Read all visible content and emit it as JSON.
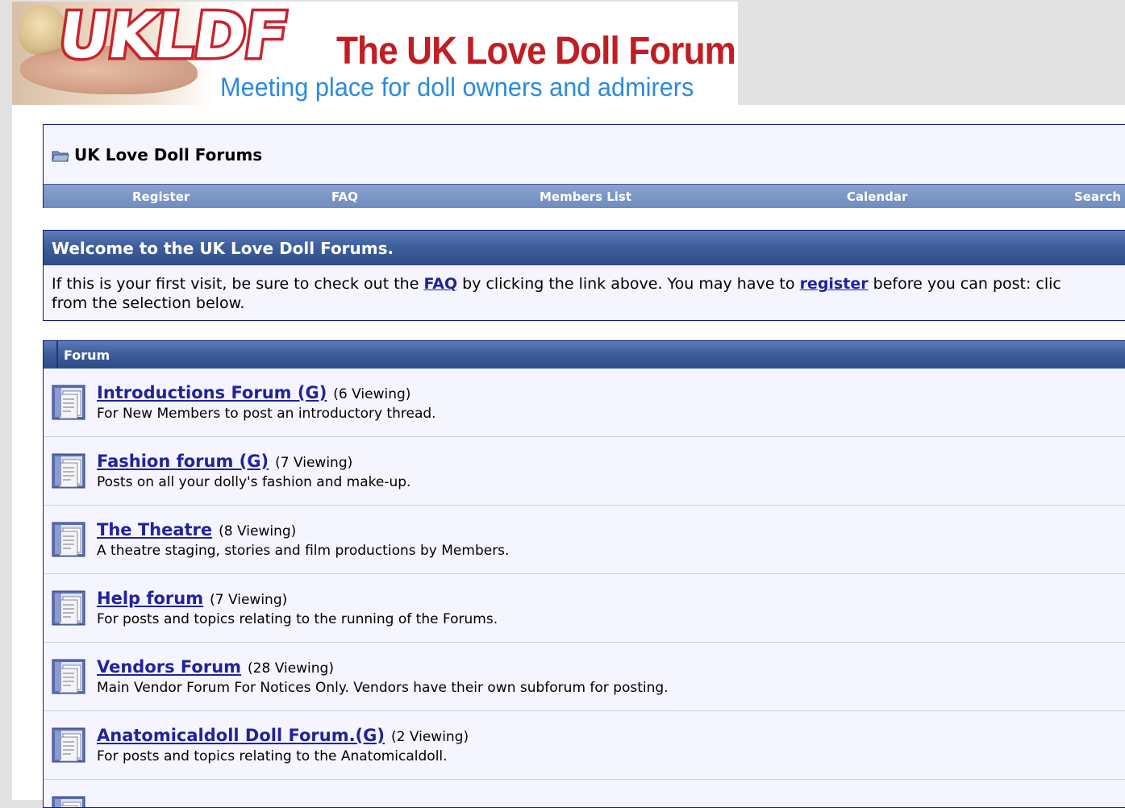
{
  "banner": {
    "logo_text": "UKLDF",
    "title": "The UK Love Doll Forum",
    "tagline": "Meeting place for doll owners and admirers"
  },
  "breadcrumb": {
    "title": "UK Love Doll Forums",
    "icon": "folder-icon"
  },
  "navbar": {
    "items": [
      {
        "label": "Register"
      },
      {
        "label": "FAQ"
      },
      {
        "label": "Members List"
      },
      {
        "label": "Calendar"
      },
      {
        "label": "Search"
      }
    ]
  },
  "welcome": {
    "title": "Welcome to the UK Love Doll Forums.",
    "text_1": "If this is your first visit, be sure to check out the ",
    "faq_link": "FAQ",
    "text_2": " by clicking the link above. You may have to ",
    "register_link": "register",
    "text_3": " before you can post: clic",
    "text_4": "from the selection below."
  },
  "forum_list": {
    "header": "Forum",
    "forums": [
      {
        "name": "Introductions Forum (G)",
        "viewing": "(6 Viewing)",
        "description": "For New Members to post an introductory thread."
      },
      {
        "name": "Fashion forum (G)",
        "viewing": "(7 Viewing)",
        "description": "Posts on all your dolly's fashion and make-up."
      },
      {
        "name": "The Theatre",
        "viewing": "(8 Viewing)",
        "description": "A theatre staging, stories and film productions by Members."
      },
      {
        "name": "Help forum",
        "viewing": "(7 Viewing)",
        "description": "For posts and topics relating to the running of the Forums."
      },
      {
        "name": "Vendors Forum",
        "viewing": "(28 Viewing)",
        "description": "Main Vendor Forum For Notices Only. Vendors have their own subforum for posting."
      },
      {
        "name": "Anatomicaldoll Doll Forum.(G)",
        "viewing": "(2 Viewing)",
        "description": "For posts and topics relating to the Anatomicaldoll."
      }
    ]
  },
  "colors": {
    "link": "#22229c",
    "header_blue": "#3f5f9c",
    "nav_blue": "#7b96c6",
    "logo_red": "#c8232d",
    "tagline_blue": "#2b8be0"
  }
}
